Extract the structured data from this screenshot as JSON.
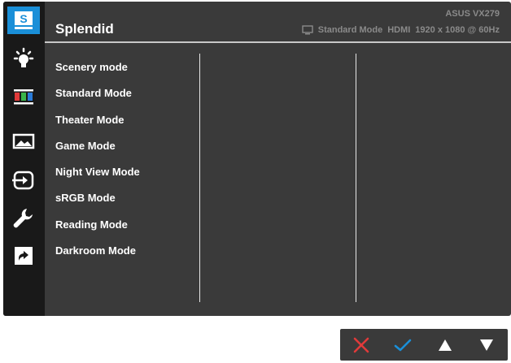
{
  "osd": {
    "title": "Splendid",
    "model": "ASUS VX279",
    "status": {
      "mode": "Standard Mode",
      "input": "HDMI",
      "resolution": "1920 x 1080 @ 60Hz"
    }
  },
  "sidebar": {
    "items": [
      {
        "icon": "splendid-icon",
        "label": "S",
        "active": true
      },
      {
        "icon": "blue-light-filter-icon"
      },
      {
        "icon": "color-icon"
      },
      {
        "icon": "image-icon"
      },
      {
        "icon": "input-select-icon"
      },
      {
        "icon": "system-setup-icon"
      },
      {
        "icon": "shortcut-icon"
      }
    ]
  },
  "menu": {
    "items": [
      "Scenery mode",
      "Standard Mode",
      "Theater Mode",
      "Game Mode",
      "Night View Mode",
      "sRGB Mode",
      "Reading Mode",
      "Darkroom Mode"
    ]
  },
  "controls": [
    {
      "icon": "close-icon",
      "color": "#e03a3a"
    },
    {
      "icon": "check-icon",
      "color": "#1a8fd8"
    },
    {
      "icon": "up-arrow-icon",
      "color": "#ffffff"
    },
    {
      "icon": "down-arrow-icon",
      "color": "#ffffff"
    }
  ],
  "colors": {
    "accent": "#1a8fd8",
    "panel": "#3a3a3a",
    "sidebar": "#191919"
  }
}
